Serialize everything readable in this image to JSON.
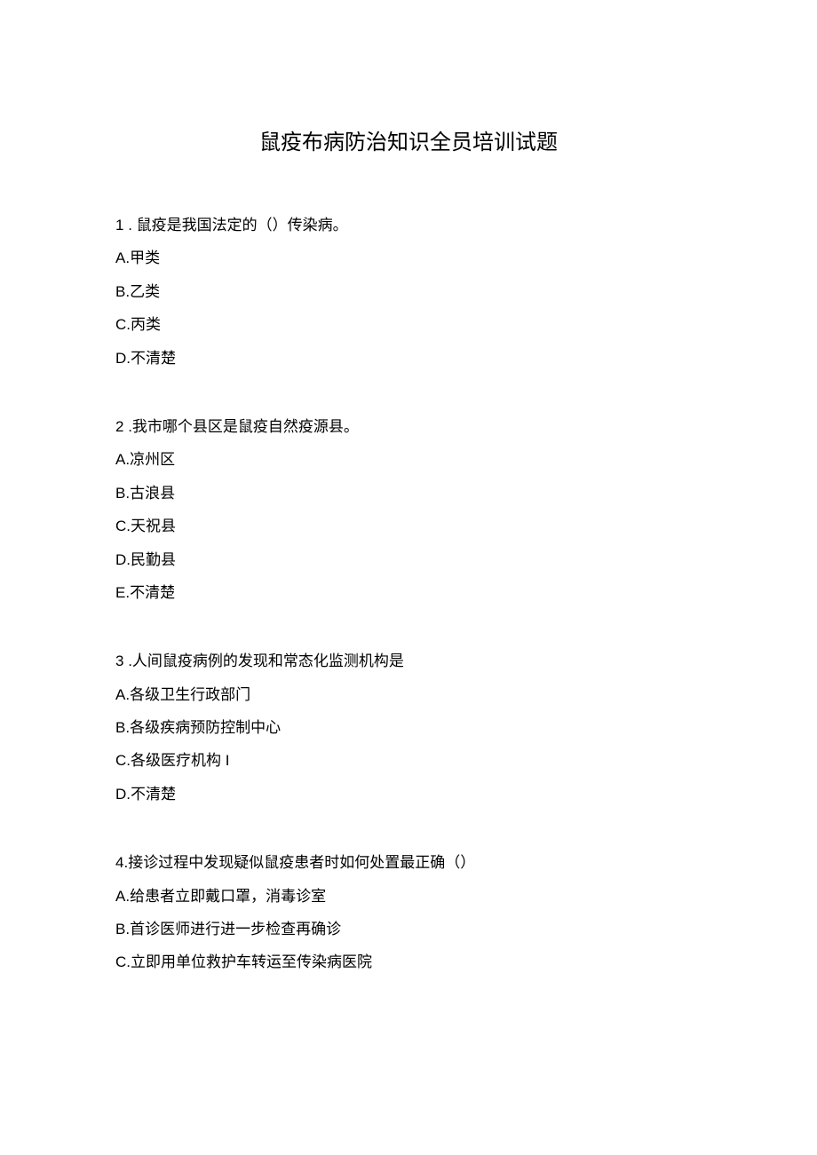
{
  "title": "鼠疫布病防治知识全员培训试题",
  "questions": [
    {
      "number": "1",
      "text": " . 鼠疫是我国法定的（）传染病。",
      "options": [
        {
          "letter": "A",
          "text": ".甲类"
        },
        {
          "letter": "B",
          "text": ".乙类"
        },
        {
          "letter": "C",
          "text": ".丙类"
        },
        {
          "letter": "D",
          "text": ".不清楚"
        }
      ]
    },
    {
      "number": "2",
      "text": "  .我市哪个县区是鼠疫自然疫源县。",
      "options": [
        {
          "letter": "A",
          "text": ".凉州区"
        },
        {
          "letter": "B",
          "text": ".古浪县"
        },
        {
          "letter": "C",
          "text": ".天祝县"
        },
        {
          "letter": "D",
          "text": ".民勤县"
        },
        {
          "letter": "E",
          "text": ".不清楚"
        }
      ]
    },
    {
      "number": "3",
      "text": "  .人间鼠疫病例的发现和常态化监测机构是",
      "options": [
        {
          "letter": "A",
          "text": ".各级卫生行政部门"
        },
        {
          "letter": "B",
          "text": ".各级疾病预防控制中心"
        },
        {
          "letter": "C",
          "text": ".各级医疗机构 I"
        },
        {
          "letter": "D",
          "text": ".不清楚"
        }
      ]
    },
    {
      "number": "4",
      "text": ".接诊过程中发现疑似鼠疫患者时如何处置最正确（）",
      "options": [
        {
          "letter": "A",
          "text": ".给患者立即戴口罩，消毒诊室"
        },
        {
          "letter": "B",
          "text": ".首诊医师进行进一步检查再确诊"
        },
        {
          "letter": "C",
          "text": ".立即用单位救护车转运至传染病医院"
        }
      ]
    }
  ]
}
